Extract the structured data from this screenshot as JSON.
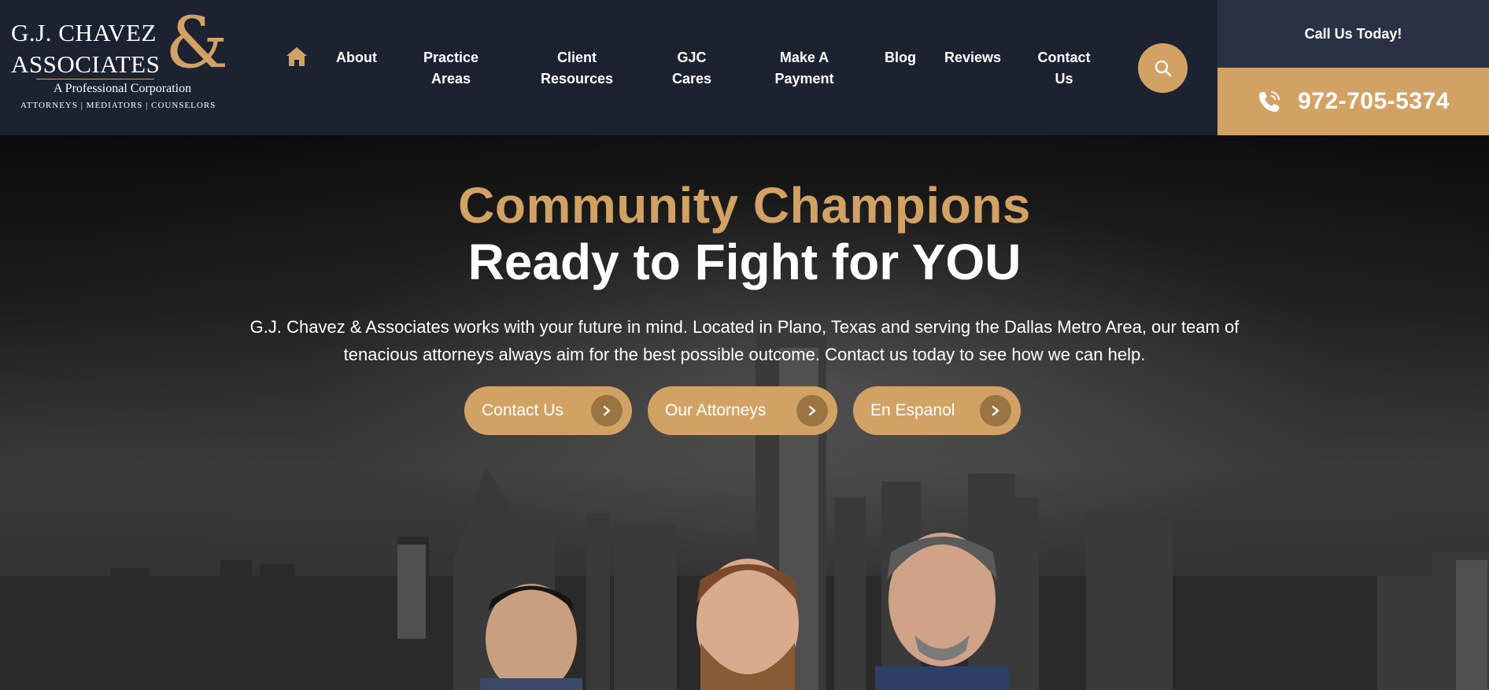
{
  "brand": {
    "name_line1": "G.J. CHAVEZ",
    "name_line2": "ASSOCIATES",
    "ampersand": "&",
    "tagline": "A Professional Corporation",
    "services": "ATTORNEYS | MEDIATORS | COUNSELORS",
    "accent_color": "#d2a265",
    "header_bg": "#1d2231"
  },
  "nav": {
    "home_icon": "home-icon",
    "items": [
      {
        "label": "About"
      },
      {
        "label": "Practice\nAreas"
      },
      {
        "label": "Client\nResources"
      },
      {
        "label": "GJC\nCares"
      },
      {
        "label": "Make A\nPayment"
      },
      {
        "label": "Blog"
      },
      {
        "label": "Reviews"
      },
      {
        "label": "Contact\nUs"
      }
    ],
    "search_icon": "search-icon"
  },
  "call": {
    "label": "Call Us Today!",
    "phone": "972-705-5374",
    "phone_icon": "phone-icon"
  },
  "hero": {
    "title_line1": "Community Champions",
    "title_line2": "Ready to Fight for YOU",
    "description_line1": "G.J. Chavez & Associates works with your future in mind. Located in Plano, Texas and serving the Dallas Metro Area, our team of",
    "description_line2": "tenacious attorneys always aim for the best possible outcome. Contact us today to see how we can help.",
    "buttons": [
      {
        "label": "Contact Us"
      },
      {
        "label": "Our Attorneys"
      },
      {
        "label": "En Espanol"
      }
    ]
  }
}
